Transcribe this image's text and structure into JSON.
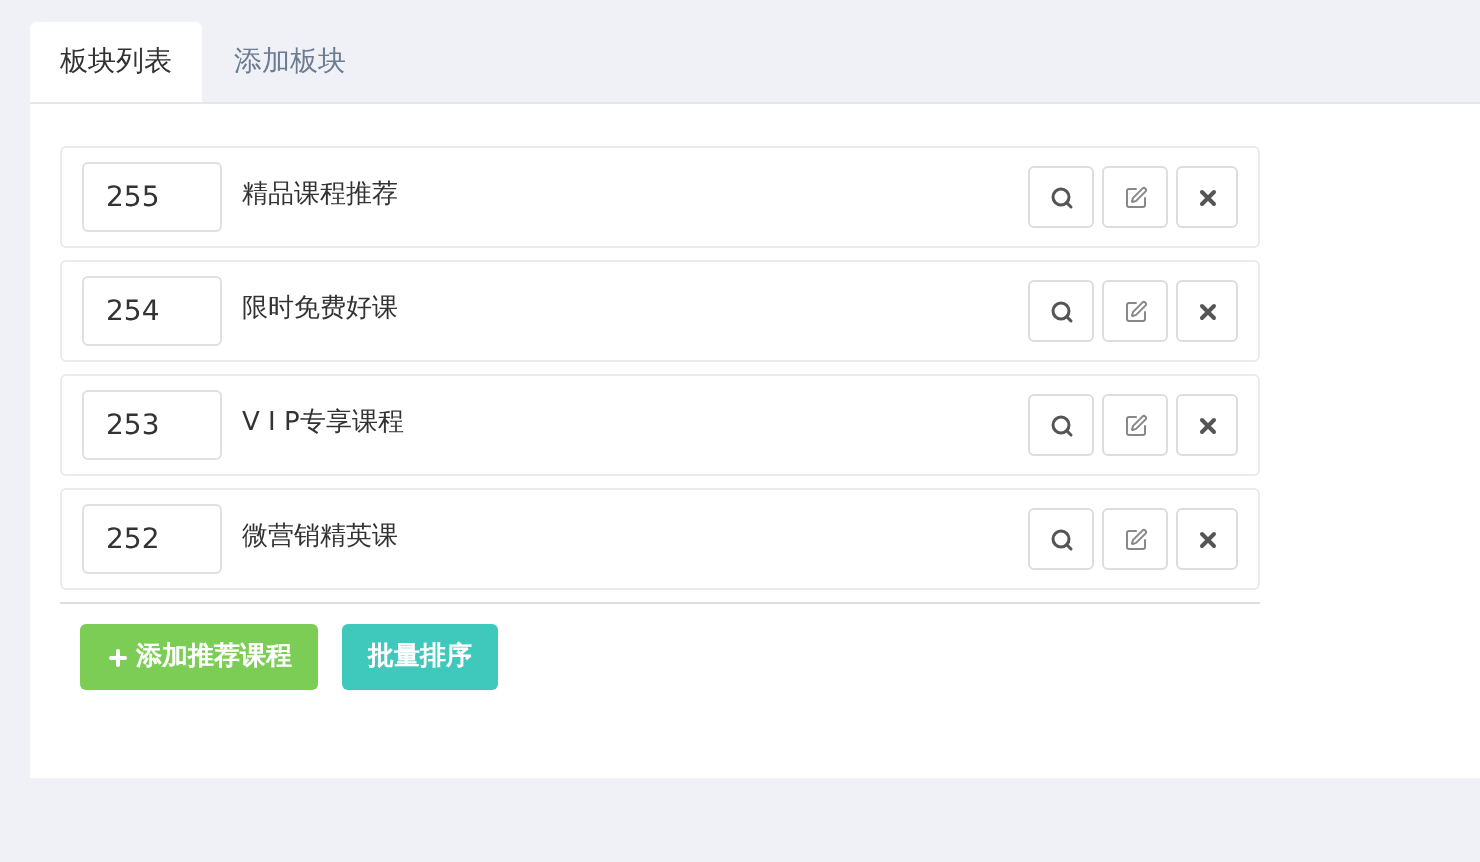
{
  "tabs": [
    {
      "label": "板块列表",
      "selected": true
    },
    {
      "label": "添加板块",
      "selected": false
    }
  ],
  "items": [
    {
      "order": "255",
      "name": "精品课程推荐"
    },
    {
      "order": "254",
      "name": "限时免费好课"
    },
    {
      "order": "253",
      "name": "V I P专享课程"
    },
    {
      "order": "252",
      "name": "微营销精英课"
    }
  ],
  "actions": [
    {
      "label": "添加推荐课程",
      "kind": "add"
    },
    {
      "label": "批量排序",
      "kind": "sort"
    }
  ]
}
